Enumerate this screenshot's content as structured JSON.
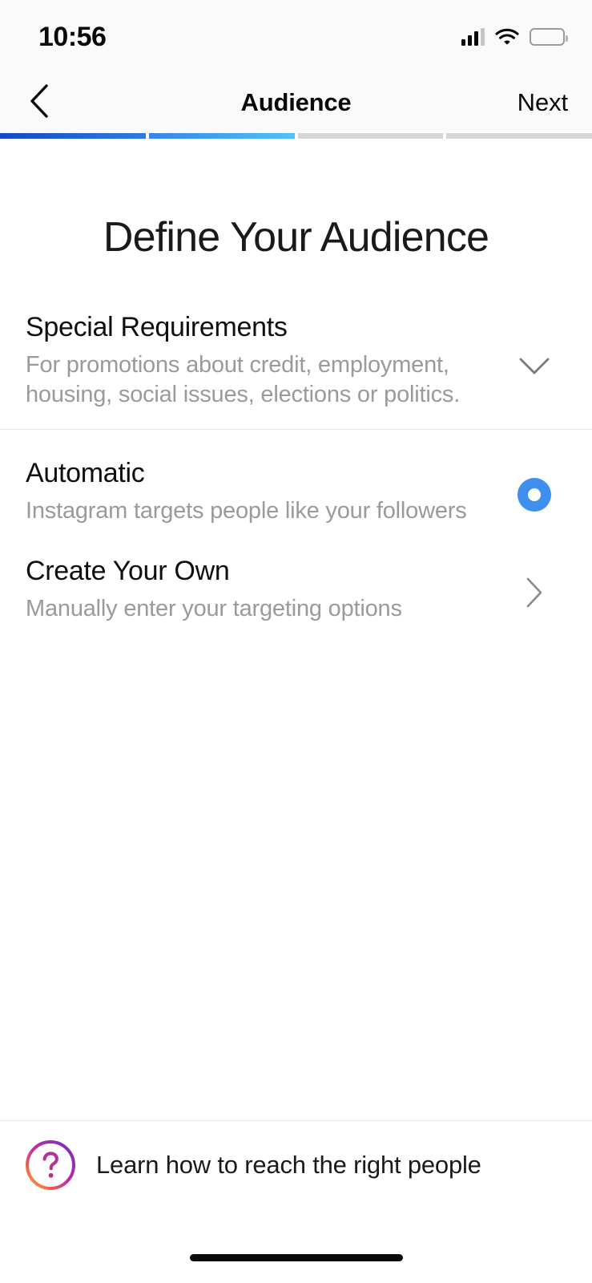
{
  "status_bar": {
    "time": "10:56",
    "signal_icon": "cellular-signal-icon",
    "wifi_icon": "wifi-icon",
    "battery_icon": "battery-icon"
  },
  "nav": {
    "back_icon": "chevron-left-icon",
    "title": "Audience",
    "next_label": "Next"
  },
  "progress": {
    "total_steps": 4,
    "completed_steps": 2,
    "segment_colors": [
      "#1549C4",
      "#4FC3F7",
      "#D6D6D6",
      "#D6D6D6"
    ]
  },
  "page": {
    "title": "Define Your Audience"
  },
  "options": [
    {
      "id": "special-requirements",
      "title": "Special Requirements",
      "subtitle": "For promotions about credit, employment, housing, social issues, elections or politics.",
      "control": "chevron-down-icon",
      "selected": false
    },
    {
      "id": "automatic",
      "title": "Automatic",
      "subtitle": "Instagram targets people like your followers",
      "control": "radio-button-selected",
      "selected": true
    },
    {
      "id": "create-your-own",
      "title": "Create Your Own",
      "subtitle": "Manually enter your targeting options",
      "control": "chevron-right-icon",
      "selected": false
    }
  ],
  "footer": {
    "help_icon": "question-mark-circle-icon",
    "label": "Learn how to reach the right people",
    "gradient_from": "#F58529",
    "gradient_to": "#8A3AB9"
  },
  "colors": {
    "accent_blue": "#3E8FEE",
    "muted_text": "#9A9A9A",
    "divider": "#E8E8E8"
  }
}
